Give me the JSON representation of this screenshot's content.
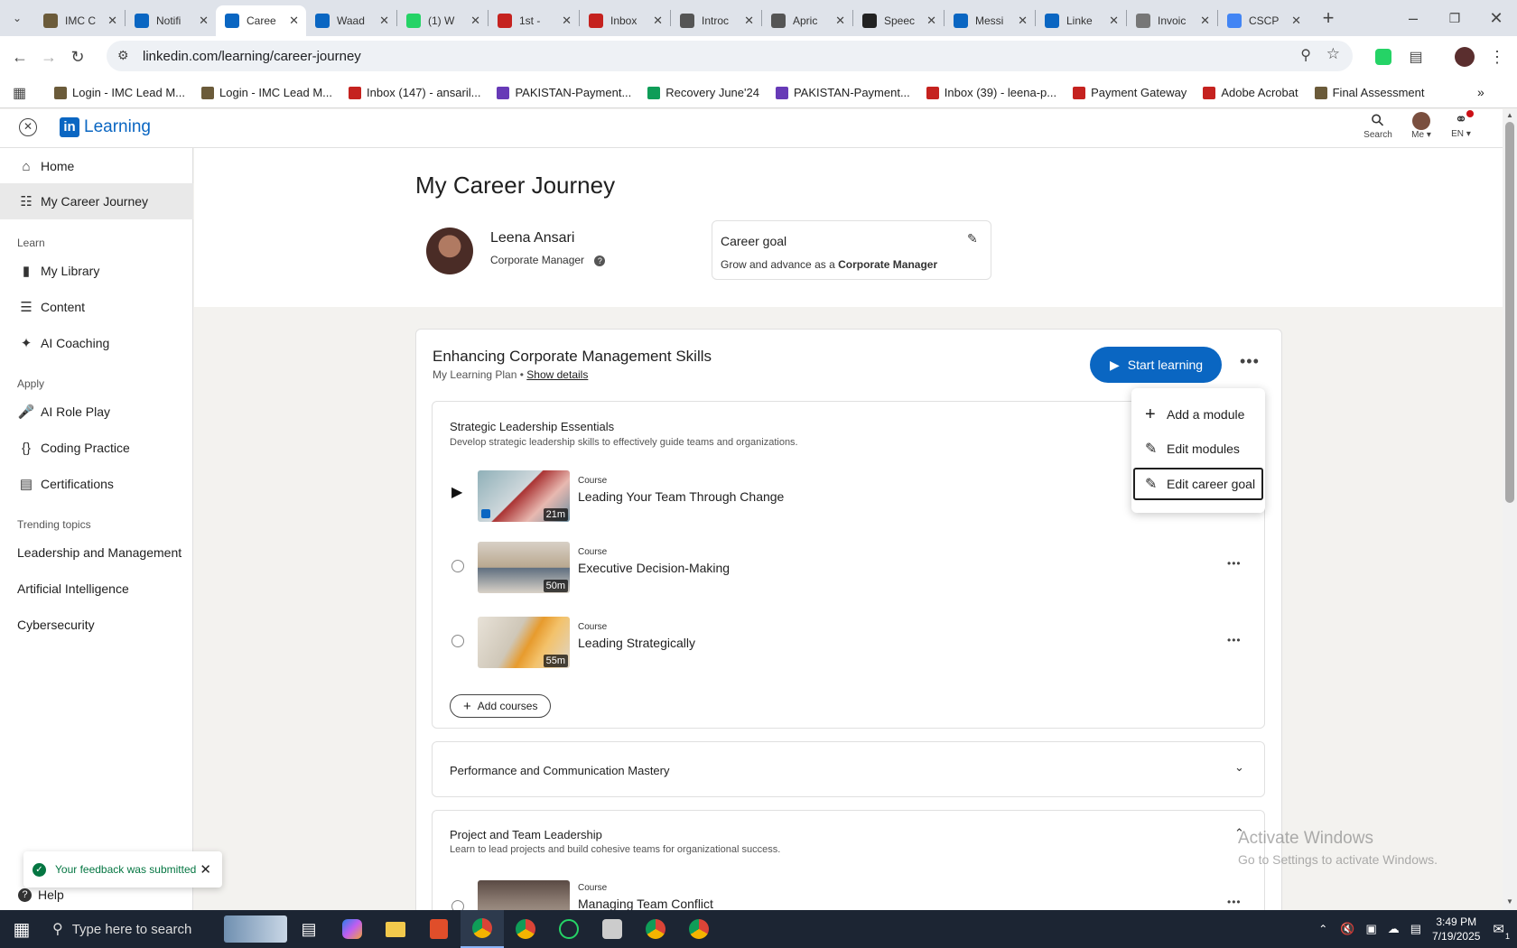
{
  "browser": {
    "tabs": [
      {
        "title": "IMC C",
        "icon_color": "#6b5b3a",
        "icon": "imc-icon"
      },
      {
        "title": "Notifi",
        "icon_color": "#0a66c2",
        "icon": "linkedin-icon"
      },
      {
        "title": "Caree",
        "icon_color": "#0a66c2",
        "icon": "linkedin-learning-icon",
        "active": true
      },
      {
        "title": "Waad",
        "icon_color": "#0a66c2",
        "icon": "linkedin-icon"
      },
      {
        "title": "(1) W",
        "icon_color": "#25d366",
        "icon": "whatsapp-icon"
      },
      {
        "title": "1st - ",
        "icon_color": "#c5221f",
        "icon": "gmail-icon"
      },
      {
        "title": "Inbox",
        "icon_color": "#c5221f",
        "icon": "gmail-icon"
      },
      {
        "title": "Introc",
        "icon_color": "#555555",
        "icon": "openai-icon"
      },
      {
        "title": "Apric",
        "icon_color": "#555555",
        "icon": "openai-icon"
      },
      {
        "title": "Speec",
        "icon_color": "#222222",
        "icon": "speech-icon"
      },
      {
        "title": "Messi",
        "icon_color": "#0a66c2",
        "icon": "linkedin-icon"
      },
      {
        "title": "Linke",
        "icon_color": "#0a66c2",
        "icon": "linkedin-icon"
      },
      {
        "title": "Invoic",
        "icon_color": "#777777",
        "icon": "globe-icon"
      },
      {
        "title": "CSCP",
        "icon_color": "#4285f4",
        "icon": "google-icon"
      }
    ],
    "url": "linkedin.com/learning/career-journey",
    "bookmarks": [
      {
        "label": "Login - IMC Lead M...",
        "color": "#6b5b3a"
      },
      {
        "label": "Login - IMC Lead M...",
        "color": "#6b5b3a"
      },
      {
        "label": "Inbox (147) - ansaril...",
        "color": "#c5221f"
      },
      {
        "label": "PAKISTAN-Payment...",
        "color": "#673ab7"
      },
      {
        "label": "Recovery June'24",
        "color": "#0f9d58"
      },
      {
        "label": "PAKISTAN-Payment...",
        "color": "#673ab7"
      },
      {
        "label": "Inbox (39) - leena-p...",
        "color": "#c5221f"
      },
      {
        "label": "Payment Gateway",
        "color": "#c5221f"
      },
      {
        "label": "Adobe Acrobat",
        "color": "#c5221f"
      },
      {
        "label": "Final Assessment",
        "color": "#6b5b3a"
      }
    ]
  },
  "header": {
    "brand": "Learning",
    "search_label": "Search",
    "me_label": "Me",
    "lang_label": "EN"
  },
  "sidebar": {
    "items": [
      {
        "label": "Home",
        "icon": "home-icon"
      },
      {
        "label": "My Career Journey",
        "icon": "map-icon"
      }
    ],
    "learn_heading": "Learn",
    "learn_items": [
      {
        "label": "My Library",
        "icon": "library-icon"
      },
      {
        "label": "Content",
        "icon": "list-icon"
      },
      {
        "label": "AI Coaching",
        "icon": "sparkle-icon"
      }
    ],
    "apply_heading": "Apply",
    "apply_items": [
      {
        "label": "AI Role Play",
        "icon": "microphone-icon"
      },
      {
        "label": "Coding Practice",
        "icon": "code-braces-icon"
      },
      {
        "label": "Certifications",
        "icon": "certificate-icon"
      }
    ],
    "trending_heading": "Trending topics",
    "trending": [
      "Leadership and Management",
      "Artificial Intelligence",
      "Cybersecurity"
    ],
    "help_label": "Help"
  },
  "profile": {
    "page_title": "My Career Journey",
    "name": "Leena Ansari",
    "role": "Corporate Manager",
    "goal_title": "Career goal",
    "goal_prefix": "Grow and advance as a",
    "goal_role": "Corporate Manager"
  },
  "plan": {
    "title": "Enhancing Corporate Management Skills",
    "subtitle": "My Learning Plan",
    "separator": "•",
    "show_details": "Show details",
    "start_label": "Start learning",
    "menu": [
      "Add a module",
      "Edit modules",
      "Edit career goal"
    ],
    "modules": [
      {
        "title": "Strategic Leadership Essentials",
        "desc": "Develop strategic leadership skills to effectively guide teams and organizations.",
        "courses": [
          {
            "type": "Course",
            "title": "Leading Your Team Through Change",
            "duration": "21m"
          },
          {
            "type": "Course",
            "title": "Executive Decision-Making",
            "duration": "50m"
          },
          {
            "type": "Course",
            "title": "Leading Strategically",
            "duration": "55m"
          }
        ],
        "add_label": "Add courses"
      },
      {
        "title": "Performance and Communication Mastery"
      },
      {
        "title": "Project and Team Leadership",
        "desc": "Learn to lead projects and build cohesive teams for organizational success.",
        "courses": [
          {
            "type": "Course",
            "title": "Managing Team Conflict"
          }
        ]
      }
    ]
  },
  "toast": {
    "message": "Your feedback was submitted"
  },
  "watermark": {
    "line1": "Activate Windows",
    "line2": "Go to Settings to activate Windows."
  },
  "taskbar": {
    "search_placeholder": "Type here to search",
    "time": "3:49 PM",
    "date": "7/19/2025",
    "notif_count": "1"
  }
}
